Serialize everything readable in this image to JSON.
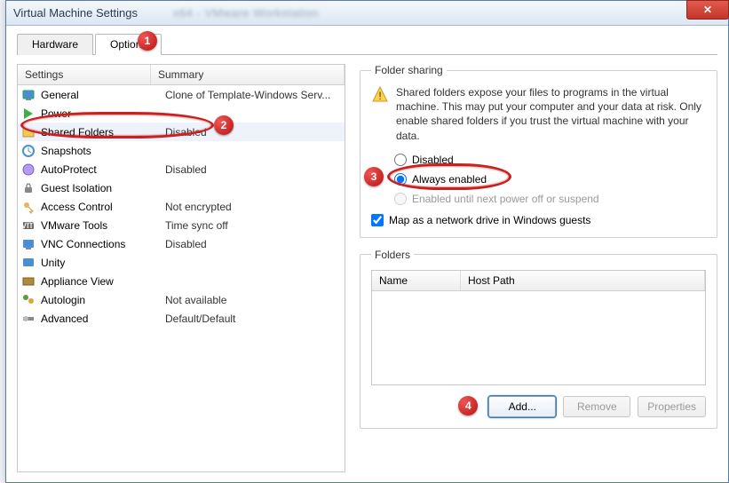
{
  "window": {
    "title": "Virtual Machine Settings",
    "blurred_hint": "x64 - VMware Workstation"
  },
  "tabs": {
    "hardware": "Hardware",
    "options": "Options"
  },
  "grid": {
    "header_settings": "Settings",
    "header_summary": "Summary",
    "rows": [
      {
        "icon": "general-icon",
        "name": "General",
        "summary": "Clone of Template-Windows Serv..."
      },
      {
        "icon": "power-icon",
        "name": "Power",
        "summary": ""
      },
      {
        "icon": "folder-icon",
        "name": "Shared Folders",
        "summary": "Disabled"
      },
      {
        "icon": "snapshot-icon",
        "name": "Snapshots",
        "summary": ""
      },
      {
        "icon": "autoprotect-icon",
        "name": "AutoProtect",
        "summary": "Disabled"
      },
      {
        "icon": "guest-isolation-icon",
        "name": "Guest Isolation",
        "summary": ""
      },
      {
        "icon": "access-icon",
        "name": "Access Control",
        "summary": "Not encrypted"
      },
      {
        "icon": "vmtools-icon",
        "name": "VMware Tools",
        "summary": "Time sync off"
      },
      {
        "icon": "vnc-icon",
        "name": "VNC Connections",
        "summary": "Disabled"
      },
      {
        "icon": "unity-icon",
        "name": "Unity",
        "summary": ""
      },
      {
        "icon": "appliance-icon",
        "name": "Appliance View",
        "summary": ""
      },
      {
        "icon": "autologin-icon",
        "name": "Autologin",
        "summary": "Not available"
      },
      {
        "icon": "advanced-icon",
        "name": "Advanced",
        "summary": "Default/Default"
      }
    ]
  },
  "folder_sharing": {
    "legend": "Folder sharing",
    "warning": "Shared folders expose your files to programs in the virtual machine. This may put your computer and your data at risk. Only enable shared folders if you trust the virtual machine with your data.",
    "opt_disabled": "Disabled",
    "opt_always": "Always enabled",
    "opt_until": "Enabled until next power off or suspend",
    "map_drive": "Map as a network drive in Windows guests"
  },
  "folders": {
    "legend": "Folders",
    "col_name": "Name",
    "col_hostpath": "Host Path",
    "btn_add": "Add...",
    "btn_remove": "Remove",
    "btn_properties": "Properties"
  },
  "annotations": {
    "a1": "1",
    "a2": "2",
    "a3": "3",
    "a4": "4"
  }
}
